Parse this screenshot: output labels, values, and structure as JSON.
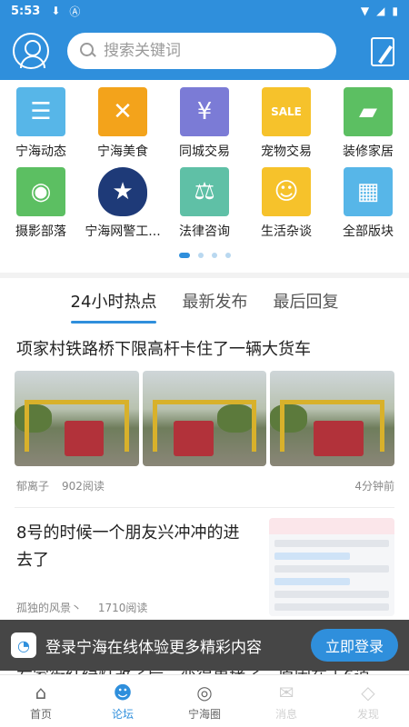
{
  "status_bar": {
    "time": "5:53",
    "icons": [
      "download-icon",
      "a-icon",
      "wifi-icon",
      "signal-icon",
      "battery-icon"
    ]
  },
  "header": {
    "search_placeholder": "搜索关键词"
  },
  "categories": [
    {
      "label": "宁海动态",
      "icon": "news-icon",
      "color": "#57b6e8"
    },
    {
      "label": "宁海美食",
      "icon": "utensils-icon",
      "color": "#f3a31b"
    },
    {
      "label": "同城交易",
      "icon": "yen-icon",
      "color": "#7b7bd6"
    },
    {
      "label": "宠物交易",
      "icon": "sale-tag-icon",
      "color": "#f6c22b"
    },
    {
      "label": "装修家居",
      "icon": "paint-roller-icon",
      "color": "#5cbf62"
    },
    {
      "label": "摄影部落",
      "icon": "camera-icon",
      "color": "#5cbf62"
    },
    {
      "label": "宁海网警工...",
      "icon": "police-badge-icon",
      "color": "#1e3a78"
    },
    {
      "label": "法律咨询",
      "icon": "scales-icon",
      "color": "#5fc0a6"
    },
    {
      "label": "生活杂谈",
      "icon": "people-icon",
      "color": "#f6c22b"
    },
    {
      "label": "全部版块",
      "icon": "grid-icon",
      "color": "#57b6e8"
    }
  ],
  "tabs": [
    {
      "label": "24小时热点",
      "active": true
    },
    {
      "label": "最新发布",
      "active": false
    },
    {
      "label": "最后回复",
      "active": false
    }
  ],
  "posts": [
    {
      "title": "项家村铁路桥下限高杆卡住了一辆大货车",
      "author": "郁离子",
      "reads": "902阅读",
      "time": "4分钟前"
    },
    {
      "title": "8号的时候一个朋友兴冲冲的进去了",
      "author": "孤独的风景丶",
      "reads": "1710阅读"
    }
  ],
  "banner": {
    "text": "登录宁海在线体验更多精彩内容",
    "button": "立即登录"
  },
  "underlying_text": "右家街红绿灯改了后，变得更堵了，原因在于6道",
  "bottom_nav": [
    {
      "label": "首页",
      "icon": "home-icon",
      "active": false
    },
    {
      "label": "论坛",
      "icon": "forum-icon",
      "active": true
    },
    {
      "label": "宁海圈",
      "icon": "circle-icon",
      "active": false
    },
    {
      "label": "消息",
      "icon": "message-icon",
      "active": false
    },
    {
      "label": "发现",
      "icon": "discover-icon",
      "active": false
    }
  ]
}
